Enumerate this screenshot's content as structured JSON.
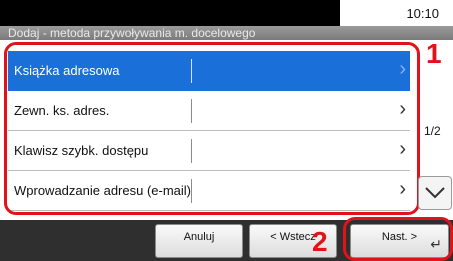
{
  "status": {
    "time": "10:10"
  },
  "header": {
    "title": "Dodaj - metoda przywoływania m. docelowego"
  },
  "list": {
    "items": [
      {
        "label": "Książka adresowa",
        "selected": true
      },
      {
        "label": "Zewn. ks. adres.",
        "selected": false
      },
      {
        "label": "Klawisz szybk. dostępu",
        "selected": false
      },
      {
        "label": "Wprowadzanie adresu (e-mail)",
        "selected": false
      }
    ],
    "chevron": "›"
  },
  "pager": {
    "text": "1/2"
  },
  "callouts": {
    "first": "1",
    "second": "2"
  },
  "buttons": {
    "cancel": "Anuluj",
    "back": "< Wstecz",
    "next": "Nast. >",
    "enter_icon": "↵"
  },
  "icons": {
    "scroll_down": "chevron-down-icon",
    "enter": "enter-icon"
  },
  "colors": {
    "selected_row": "#1a6fd8",
    "callout": "#e0121a",
    "bottom_bar": "#2f2f2f"
  }
}
